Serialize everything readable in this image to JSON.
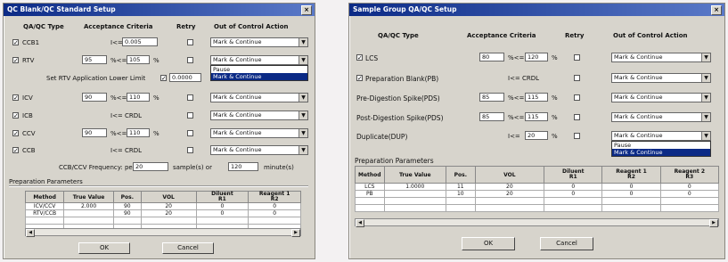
{
  "d1": {
    "title": "QC Blank/QC Standard Setup",
    "headers": {
      "type": "QA/QC Type",
      "criteria": "Acceptance Criteria",
      "retry": "Retry",
      "action": "Out of Control Action"
    },
    "rows": [
      {
        "label": "CCB1",
        "checked": true,
        "low": "",
        "op": "I<=",
        "high": "0.005",
        "unit": "",
        "action": "Mark & Continue"
      },
      {
        "label": "RTV",
        "checked": true,
        "low": "95",
        "op": "%<=",
        "high": "105",
        "unit": "%",
        "action": "Mark & Continue"
      },
      {
        "label": "ICV",
        "checked": true,
        "low": "90",
        "op": "%<=",
        "high": "110",
        "unit": "%",
        "action": "Mark & Continue"
      },
      {
        "label": "ICB",
        "checked": true,
        "low": "",
        "op": "I<= CRDL",
        "high": "",
        "unit": "",
        "action": "Mark & Continue"
      },
      {
        "label": "CCV",
        "checked": true,
        "low": "90",
        "op": "%<=",
        "high": "110",
        "unit": "%",
        "action": "Mark & Continue"
      },
      {
        "label": "CCB",
        "checked": true,
        "low": "",
        "op": "I<= CRDL",
        "high": "",
        "unit": "",
        "action": "Mark & Continue"
      }
    ],
    "rtv_limit_label": "Set RTV Application Lower Limit",
    "rtv_limit_value": "0.0000",
    "dropdown_options": [
      "Pause",
      "Mark & Continue"
    ],
    "freq_label": "CCB/CCV Frequency: per",
    "freq_value1": "20",
    "freq_mid": "sample(s) or",
    "freq_value2": "120",
    "freq_unit": "minute(s)",
    "prep_label": "Preparation Parameters",
    "table_headers": [
      "Method",
      "True Value",
      "Pos.",
      "VOL",
      "Diluent\nR1",
      "Reagent 1\nR2"
    ],
    "table_rows": [
      [
        "ICV/CCV",
        "2.000",
        "90",
        "20",
        "0",
        "0"
      ],
      [
        "RTV/CCB",
        "",
        "90",
        "20",
        "0",
        "0"
      ]
    ],
    "ok": "OK",
    "cancel": "Cancel"
  },
  "d2": {
    "title": "Sample Group QA/QC Setup",
    "headers": {
      "type": "QA/QC Type",
      "criteria": "Acceptance Criteria",
      "retry": "Retry",
      "action": "Out of Control Action"
    },
    "rows": [
      {
        "label": "LCS",
        "checked": true,
        "low": "80",
        "op": "%<=",
        "high": "120",
        "unit": "%",
        "action": "Mark & Continue"
      },
      {
        "label": "Preparation Blank(PB)",
        "checked": true,
        "low": "",
        "op": "I<= CRDL",
        "high": "",
        "unit": "",
        "action": "Mark & Continue"
      },
      {
        "label": "Pre-Digestion Spike(PDS)",
        "checked": false,
        "low": "85",
        "op": "%<=",
        "high": "115",
        "unit": "%",
        "action": "Mark & Continue"
      },
      {
        "label": "Post-Digestion Spike(PDS)",
        "checked": false,
        "low": "85",
        "op": "%<=",
        "high": "115",
        "unit": "%",
        "action": "Mark & Continue"
      },
      {
        "label": "Duplicate(DUP)",
        "checked": false,
        "low": "",
        "op": "I<=",
        "high": "20",
        "unit": "%",
        "action": "Mark & Continue"
      }
    ],
    "dropdown_options": [
      "Pause",
      "Mark & Continue"
    ],
    "prep_label": "Preparation Parameters",
    "table_headers": [
      "Method",
      "True Value",
      "Pos.",
      "VOL",
      "Diluent\nR1",
      "Reagent 1\nR2",
      "Reagent 2\nR3"
    ],
    "table_rows": [
      [
        "LCS",
        "1.0000",
        "11",
        "20",
        "0",
        "0",
        "0"
      ],
      [
        "PB",
        "",
        "10",
        "20",
        "0",
        "0",
        "0"
      ]
    ],
    "ok": "OK",
    "cancel": "Cancel"
  }
}
